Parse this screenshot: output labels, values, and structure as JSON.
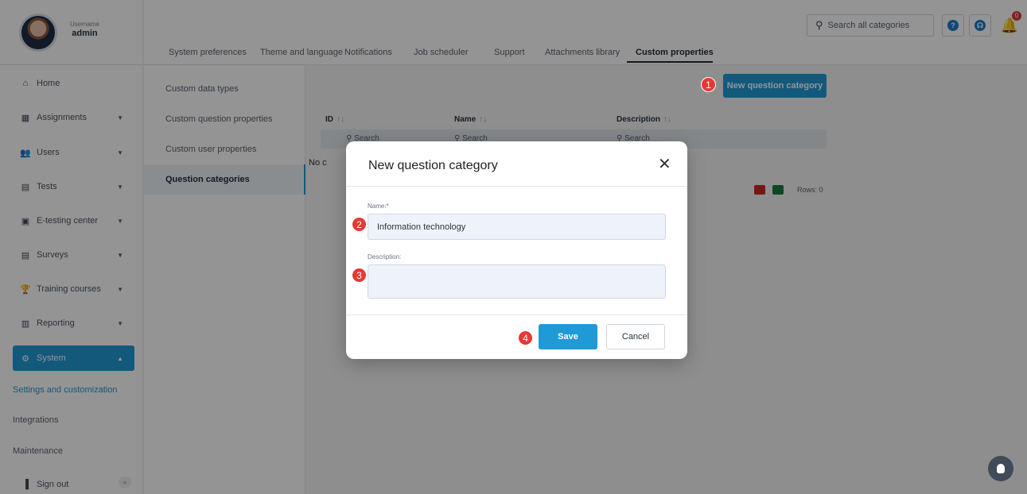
{
  "profile": {
    "label": "Username",
    "user": "admin"
  },
  "nav": [
    {
      "label": "Home",
      "icon": "home-icon",
      "glyph": "⌂"
    },
    {
      "label": "Assignments",
      "icon": "assignments-icon",
      "glyph": "▦",
      "expandable": true
    },
    {
      "label": "Users",
      "icon": "users-icon",
      "glyph": "👥",
      "expandable": true
    },
    {
      "label": "Tests",
      "icon": "tests-icon",
      "glyph": "▤",
      "expandable": true
    },
    {
      "label": "E-testing center",
      "icon": "calendar-icon",
      "glyph": "▣",
      "expandable": true
    },
    {
      "label": "Surveys",
      "icon": "surveys-icon",
      "glyph": "▤",
      "expandable": true
    },
    {
      "label": "Training courses",
      "icon": "trophy-icon",
      "glyph": "🏆",
      "expandable": true
    },
    {
      "label": "Reporting",
      "icon": "reporting-icon",
      "glyph": "▥",
      "expandable": true
    },
    {
      "label": "System",
      "icon": "gear-icon",
      "glyph": "⚙",
      "expandable": true,
      "active": true
    }
  ],
  "system_sub": [
    {
      "label": "Settings and customization",
      "active": true
    },
    {
      "label": "Integrations"
    },
    {
      "label": "Maintenance"
    }
  ],
  "sign_out": "Sign out",
  "tabs": [
    "System preferences",
    "Theme and language",
    "Notifications",
    "Job scheduler",
    "Support",
    "Attachments library",
    "Custom properties"
  ],
  "active_tab": "Custom properties",
  "search": {
    "placeholder": "Search all categories"
  },
  "notifications_count": "0",
  "submenu": [
    "Custom data types",
    "Custom question properties",
    "Custom user properties",
    "Question categories"
  ],
  "main": {
    "new_button": "New question category",
    "columns": [
      "ID",
      "Name",
      "Description"
    ],
    "sort_glyph": "↑↓",
    "filter_placeholder": "Search",
    "no_data": "No c",
    "rows_label": "Rows: 0"
  },
  "dialog": {
    "title": "New question category",
    "name_label": "Name:*",
    "name_value": "Information technology",
    "description_label": "Description:",
    "description_value": "",
    "save": "Save",
    "cancel": "Cancel"
  },
  "steps": [
    "1",
    "2",
    "3",
    "4"
  ],
  "colors": {
    "accent": "#1f9ad6",
    "marker": "#e53935"
  }
}
